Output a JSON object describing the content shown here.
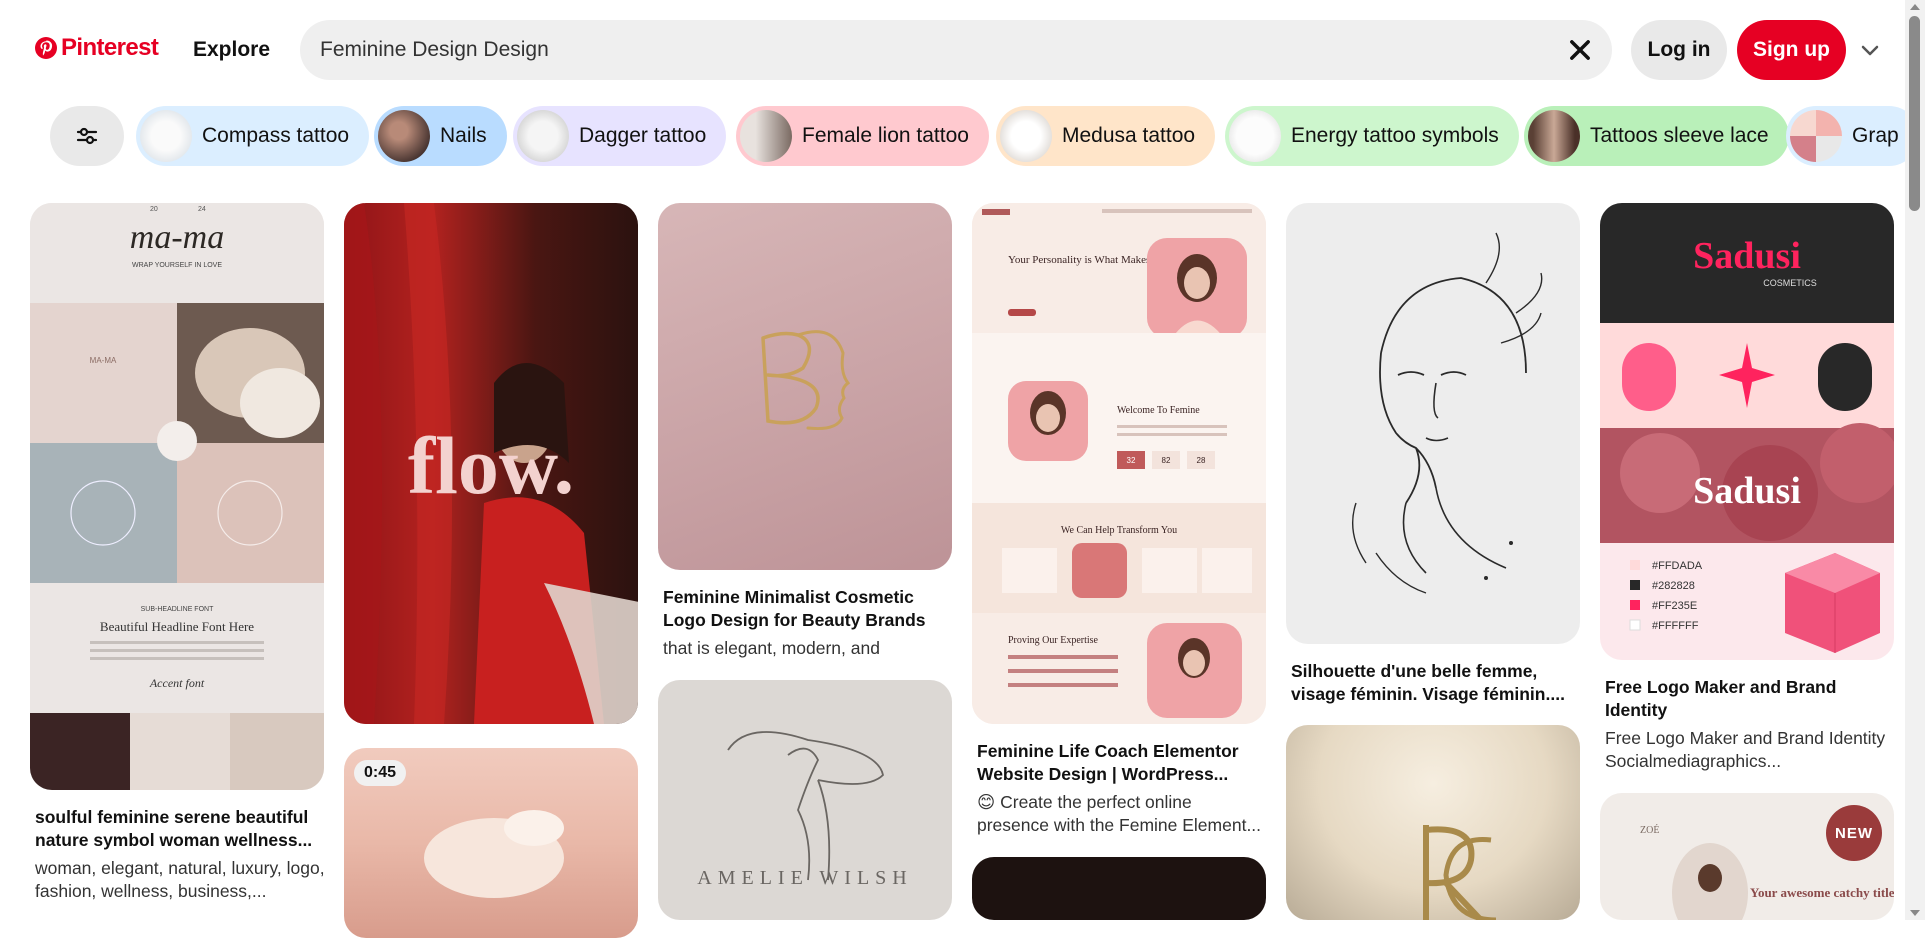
{
  "header": {
    "logo_text": "Pinterest",
    "explore_label": "Explore",
    "search_value": "Feminine Design Design",
    "login_label": "Log in",
    "signup_label": "Sign up",
    "brand_color": "#e60023"
  },
  "chips": [
    {
      "label": "Compass tattoo",
      "bg": "#dbeeff"
    },
    {
      "label": "Nails",
      "bg": "#b9dcff"
    },
    {
      "label": "Dagger tattoo",
      "bg": "#e7e3ff"
    },
    {
      "label": "Female lion tattoo",
      "bg": "#ffc9cf"
    },
    {
      "label": "Medusa tattoo",
      "bg": "#ffe5c9"
    },
    {
      "label": "Energy tattoo symbols",
      "bg": "#cdf6cd"
    },
    {
      "label": "Tattoos sleeve lace",
      "bg": "#b9f0b9"
    },
    {
      "label": "Grap",
      "bg": "#dbeeff"
    }
  ],
  "pins": [
    {
      "title": "soulful feminine serene beautiful nature symbol woman wellness...",
      "desc": "woman, elegant, natural, luxury, logo, fashion, wellness, business,..."
    },
    {
      "title": "",
      "desc": ""
    },
    {
      "title": "Feminine Minimalist Cosmetic Logo Design for Beauty Brands",
      "desc": "that is elegant, modern, and"
    },
    {
      "title": "Feminine Life Coach Elementor Website Design | WordPress...",
      "desc": "😊 Create the perfect online presence with the Femine Element..."
    },
    {
      "title": "Silhouette d'une belle femme, visage féminin. Visage féminin....",
      "desc": ""
    },
    {
      "title": "Free Logo Maker and Brand Identity",
      "desc": "Free Logo Maker and Brand Identity Socialmediagraphics..."
    }
  ],
  "pin_art": {
    "mama": {
      "year_left": "20",
      "year_right": "24",
      "brand": "ma-ma",
      "tagline": "WRAP YOURSELF IN LOVE",
      "badge_text": "MA-MA",
      "sub_headline": "SUB-HEADLINE FONT",
      "headline": "Beautiful Headline Font Here",
      "accent": "Accent font"
    },
    "flow": {
      "word": "flow."
    },
    "video": {
      "duration": "0:45"
    },
    "amelie": {
      "name": "AMELIE WILSH"
    },
    "coach": {
      "hero": "Your Personality is What Makes You Character",
      "welcome": "Welcome To Femine",
      "help": "We Can Help Transform You",
      "expertise": "Proving Our Expertise",
      "stats": [
        "32",
        "82",
        "28"
      ]
    },
    "sadus": {
      "brand": "Sadusi",
      "sub": "COSMETICS",
      "colors": [
        {
          "hex": "#FFDADA",
          "label": "#FFDADA"
        },
        {
          "hex": "#282828",
          "label": "#282828"
        },
        {
          "hex": "#FF235E",
          "label": "#FF235E"
        },
        {
          "hex": "#FFFFFF",
          "label": "#FFFFFF"
        }
      ]
    },
    "zoe": {
      "brand": "ZOÉ",
      "badge": "NEW",
      "headline": "Your awesome catchy title"
    }
  }
}
